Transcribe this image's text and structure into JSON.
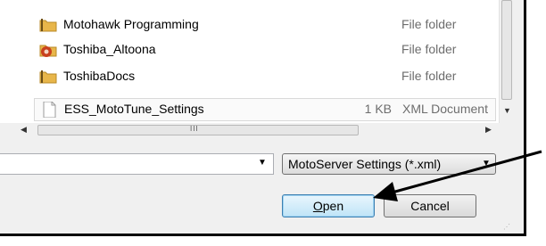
{
  "files": [
    {
      "name": "Motohawk Programming",
      "size": "",
      "type": "File folder",
      "icon": "folder-icon"
    },
    {
      "name": "Toshiba_Altoona",
      "size": "",
      "type": "File folder",
      "icon": "special-folder-icon"
    },
    {
      "name": "ToshibaDocs",
      "size": "",
      "type": "File folder",
      "icon": "folder-icon"
    },
    {
      "name": "ESS_MotoTune_Settings",
      "size": "1 KB",
      "type": "XML Document",
      "icon": "document-icon"
    }
  ],
  "scrollbar": {
    "grip": "III",
    "up_arrow": "▲",
    "down_arrow": "▼",
    "left_arrow": "◀",
    "right_arrow": "▶"
  },
  "filename_field": {
    "value": "",
    "dropdown": "▼"
  },
  "filetype_select": {
    "value": "MotoServer Settings (*.xml)",
    "dropdown": "▼"
  },
  "buttons": {
    "open_prefix": "",
    "open_underlined": "O",
    "open_rest": "pen",
    "cancel": "Cancel"
  },
  "colors": {
    "folder": "#e8b64a",
    "special_folder": "#c8401e",
    "annotation_arrow": "#000000"
  }
}
